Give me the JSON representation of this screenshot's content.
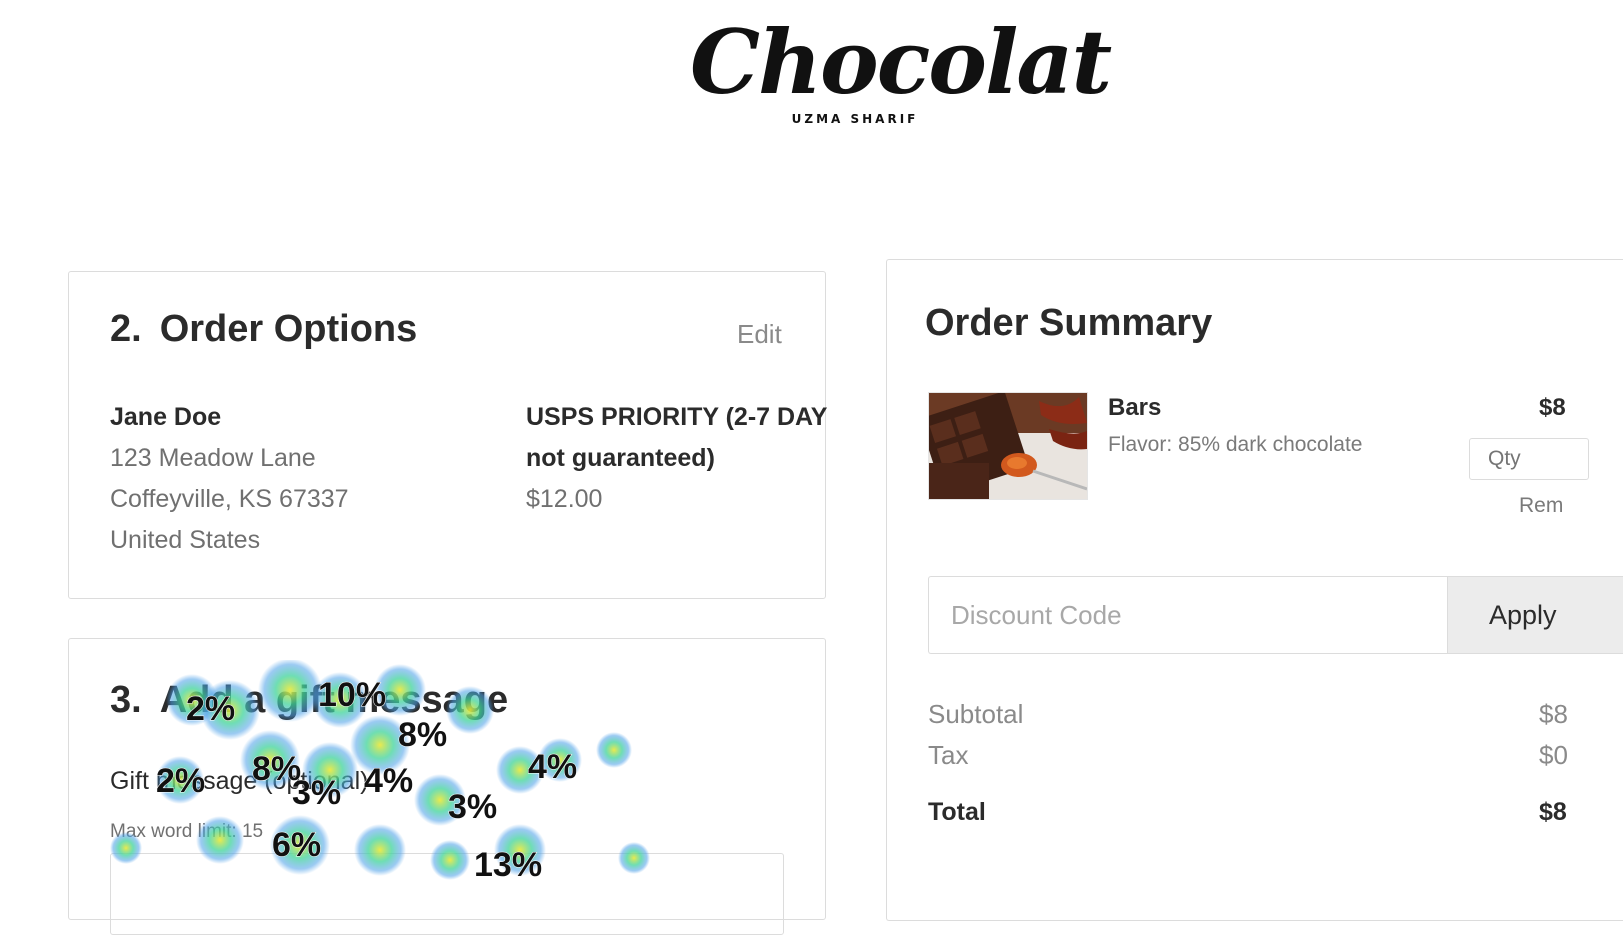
{
  "logo": {
    "wordmark": "Chocolat",
    "tagline": "UZMA SHARIF"
  },
  "order_options": {
    "number": "2.",
    "title": "Order Options",
    "edit_label": "Edit",
    "address": {
      "name": "Jane Doe",
      "street": "123 Meadow Lane",
      "city_line": "Coffeyville, KS 67337",
      "country": "United States"
    },
    "shipping": {
      "method": "USPS PRIORITY (2-7 DAY not guaranteed)",
      "price": "$12.00"
    }
  },
  "gift_message": {
    "number": "3.",
    "title": "Add a gift message",
    "field_label": "Gift message (optional)",
    "limit_text": "Max word limit: 15"
  },
  "order_summary": {
    "title": "Order Summary",
    "item": {
      "name": "Bars",
      "variant": "Flavor: 85% dark chocolate",
      "price": "$8",
      "qty_placeholder": "Qty",
      "remove_label": "Rem"
    },
    "discount": {
      "placeholder": "Discount Code",
      "apply_label": "Apply"
    },
    "subtotal_label": "Subtotal",
    "subtotal_value": "$8",
    "tax_label": "Tax",
    "tax_value": "$0",
    "total_label": "Total",
    "total_value": "$8"
  },
  "heatmap_labels": [
    "2%",
    "10%",
    "8%",
    "2%",
    "8%",
    "3%",
    "4%",
    "4%",
    "3%",
    "6%",
    "13%"
  ],
  "colors": {
    "border": "#dcdcdc",
    "muted_text": "#707070",
    "apply_bg": "#ececec"
  }
}
